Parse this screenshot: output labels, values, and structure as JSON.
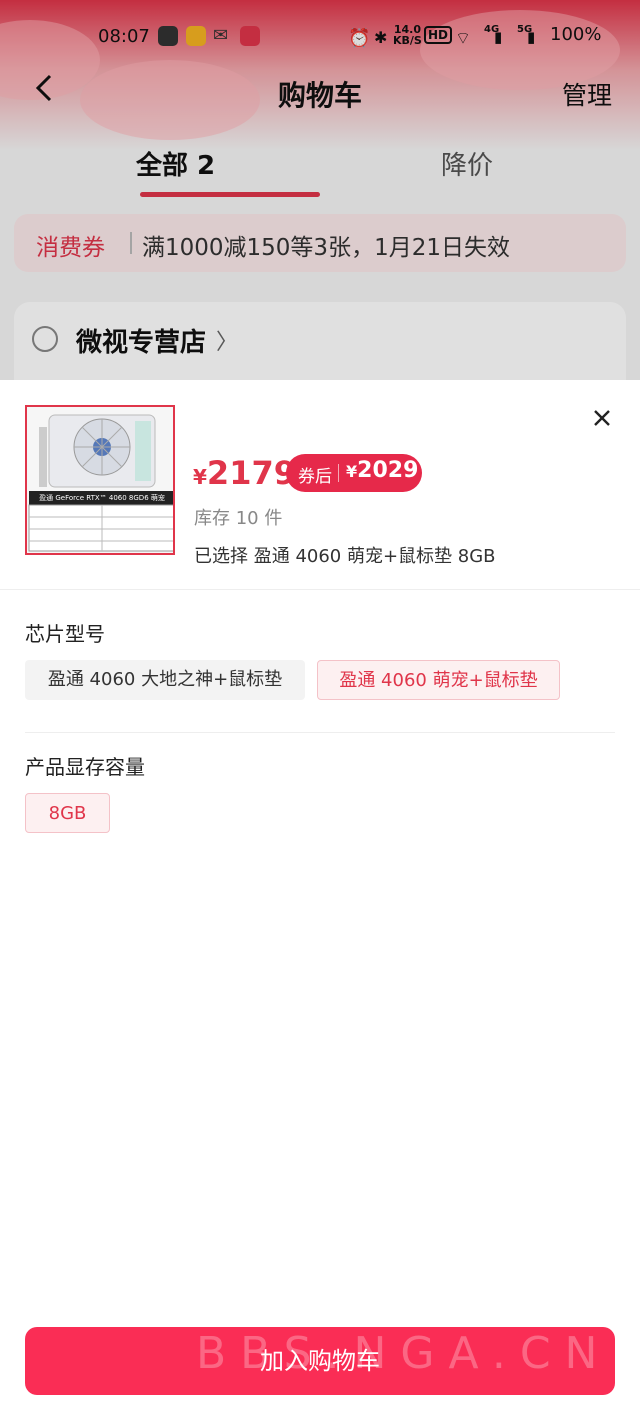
{
  "statusbar": {
    "time": "08:07",
    "net_speed": "14.0",
    "net_unit": "KB/S",
    "hd": "HD",
    "sig1": "4G",
    "sig2": "5G",
    "battery": "100%"
  },
  "nav": {
    "title": "购物车",
    "manage": "管理"
  },
  "tabs": [
    {
      "label": "全部 2"
    },
    {
      "label": "降价"
    }
  ],
  "coupon": {
    "tag": "消费券",
    "text": "满1000减150等3张，1月21日失效"
  },
  "shop": {
    "name": "微视专营店"
  },
  "product": {
    "image_caption": "盈通 GeForce RTX™ 4060 8GD6 萌宠",
    "currency": "¥",
    "price": "2179",
    "after_coupon_label": "券后",
    "after_coupon_price": "2029",
    "stock": "库存 10 件",
    "selected": "已选择  盈通 4060 萌宠+鼠标垫 8GB"
  },
  "sections": {
    "chip": {
      "title": "芯片型号",
      "options": [
        "盈通 4060 大地之神+鼠标垫",
        "盈通 4060 萌宠+鼠标垫"
      ],
      "selected_index": 1
    },
    "memory": {
      "title": "产品显存容量",
      "options": [
        "8GB"
      ],
      "selected_index": 0
    }
  },
  "add_cart_label": "加入购物车",
  "watermark": "BBS.NGA.CN",
  "colors": {
    "accent": "#fa2d55",
    "price": "#e0354a"
  }
}
